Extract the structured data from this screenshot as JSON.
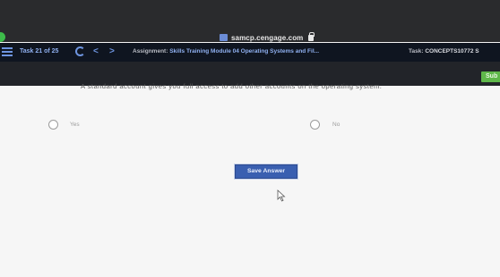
{
  "browser": {
    "url": "samcp.cengage.com"
  },
  "toolbar": {
    "task_count": "Task 21 of 25",
    "assignment_label": "Assignment:",
    "assignment_value": "Skills Training Module 04 Operating Systems and Fil...",
    "task_label": "Task:",
    "task_value": "CONCEPTS10772 S"
  },
  "header": {
    "submit_label": "Sub"
  },
  "question": {
    "text": "A standard account gives you full access to add other accounts on the operating system.",
    "options": [
      {
        "label": "Yes"
      },
      {
        "label": "No"
      }
    ],
    "save_label": "Save Answer"
  }
}
